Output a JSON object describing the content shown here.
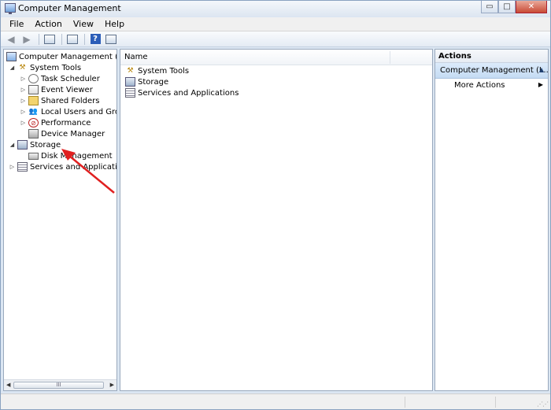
{
  "window": {
    "title": "Computer Management",
    "controls": {
      "minimize": "▭",
      "maximize": "□",
      "close": "✕"
    }
  },
  "menu": [
    "File",
    "Action",
    "View",
    "Help"
  ],
  "toolbar": {
    "back_icon": "back-arrow-icon",
    "forward_icon": "forward-arrow-icon",
    "help_glyph": "?"
  },
  "tree": {
    "root": "Computer Management (Local",
    "system_tools": "System Tools",
    "task_scheduler": "Task Scheduler",
    "event_viewer": "Event Viewer",
    "shared_folders": "Shared Folders",
    "local_users": "Local Users and Groups",
    "performance": "Performance",
    "device_manager": "Device Manager",
    "storage": "Storage",
    "disk_management": "Disk Management",
    "services": "Services and Applications",
    "scrollbar_thumb": "III"
  },
  "content": {
    "column_header": "Name",
    "items": [
      "System Tools",
      "Storage",
      "Services and Applications"
    ]
  },
  "actions": {
    "header": "Actions",
    "group": "Computer Management (L...",
    "more_actions": "More Actions"
  },
  "annotation": {
    "arrow_color": "#e02020"
  },
  "colors": {
    "window_frame": "#dbe6f2",
    "action_group_bg": "#c4dbf3"
  }
}
